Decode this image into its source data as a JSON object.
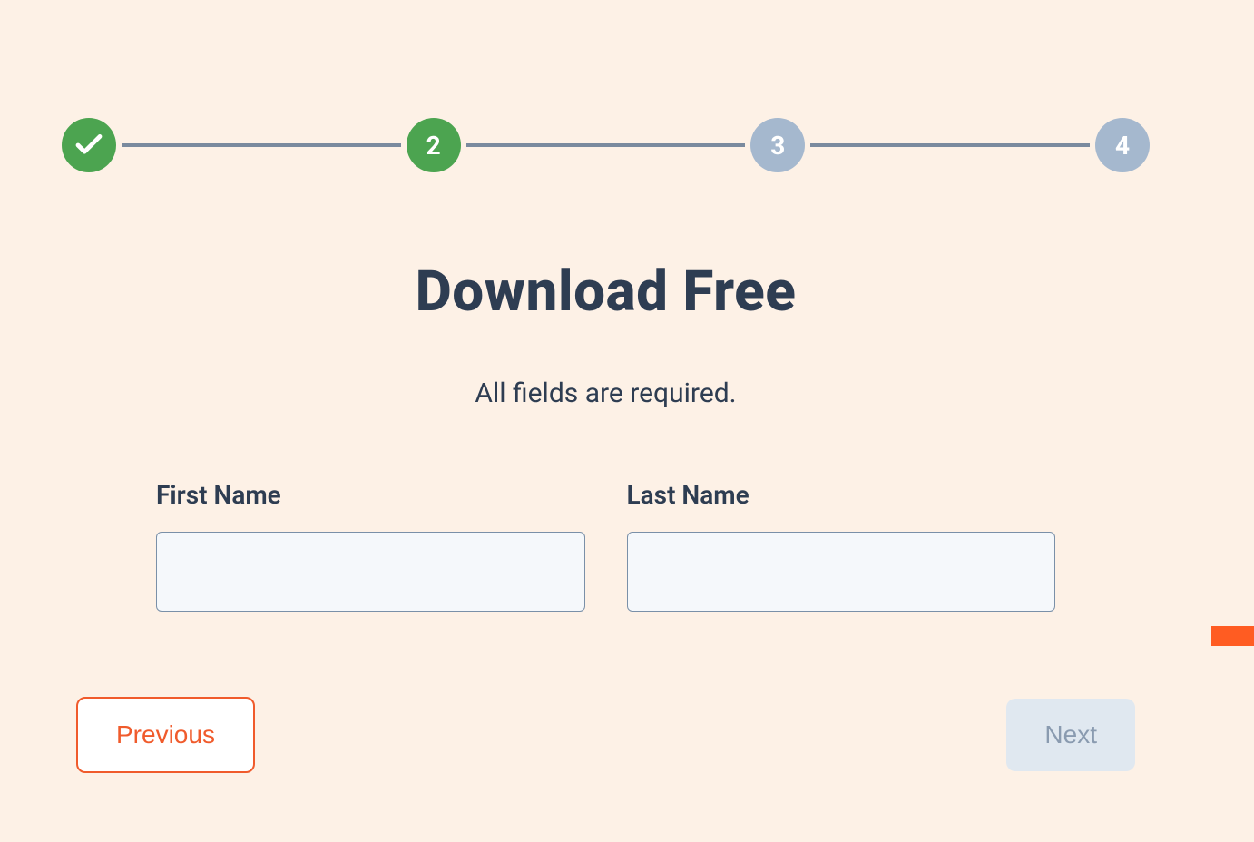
{
  "stepper": {
    "steps": [
      {
        "label": "",
        "status": "completed"
      },
      {
        "label": "2",
        "status": "active"
      },
      {
        "label": "3",
        "status": "pending"
      },
      {
        "label": "4",
        "status": "pending"
      }
    ]
  },
  "heading": {
    "title": "Download Free",
    "subtitle": "All fields are required."
  },
  "form": {
    "first_name": {
      "label": "First Name",
      "value": ""
    },
    "last_name": {
      "label": "Last Name",
      "value": ""
    }
  },
  "buttons": {
    "previous": "Previous",
    "next": "Next"
  }
}
